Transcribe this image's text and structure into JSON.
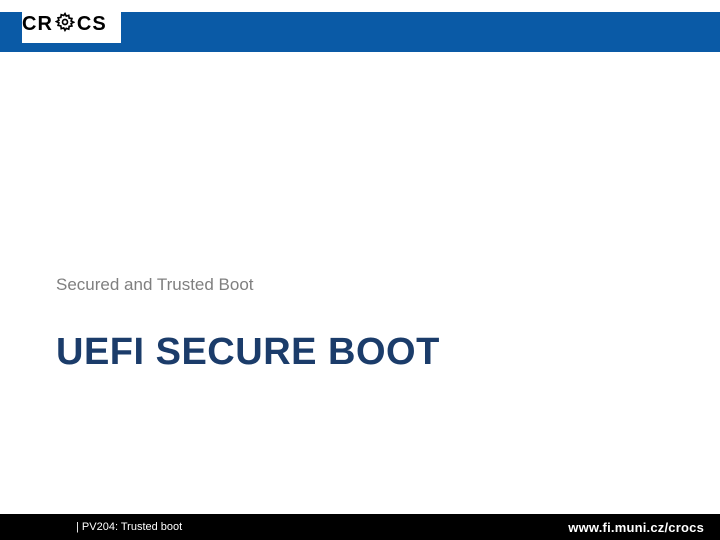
{
  "header": {
    "logo_left": "CR",
    "logo_right": "CS",
    "brand_color": "#0a5aa6"
  },
  "content": {
    "kicker": "Secured and Trusted Boot",
    "title": "UEFI SECURE BOOT"
  },
  "footer": {
    "left": "| PV204: Trusted boot",
    "right": "www.fi.muni.cz/crocs"
  }
}
